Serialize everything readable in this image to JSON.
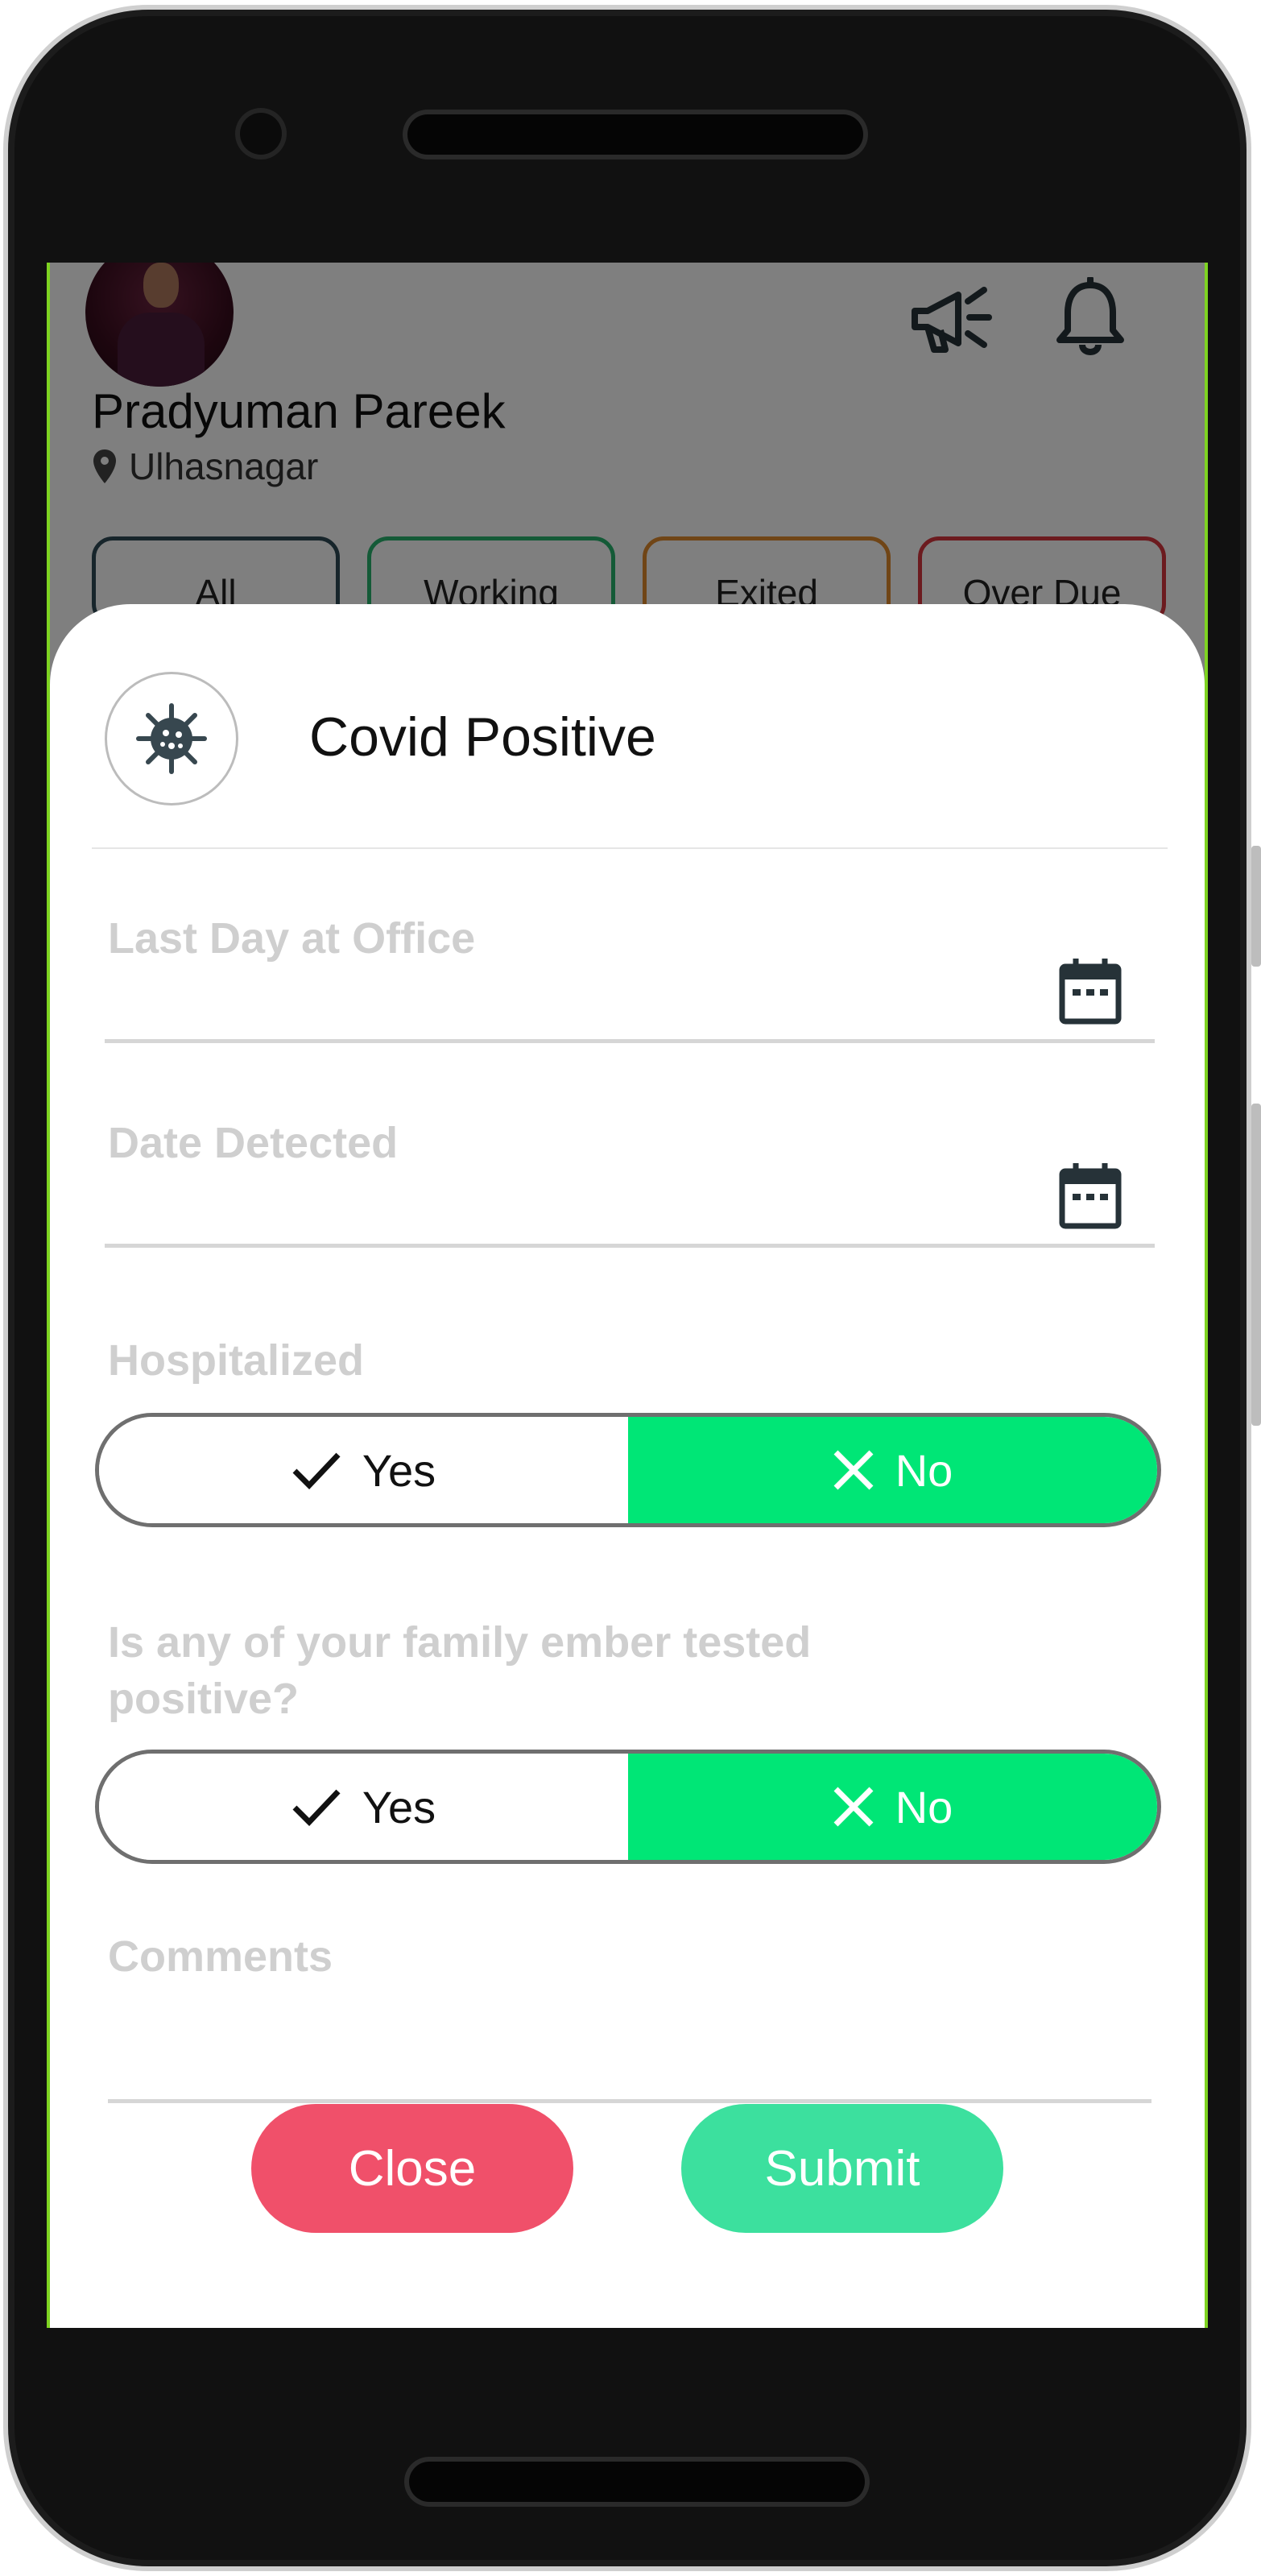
{
  "profile": {
    "name": "Pradyuman Pareek",
    "location": "Ulhasnagar"
  },
  "filters": [
    {
      "label": "All",
      "color": "#2f4a56"
    },
    {
      "label": "Working",
      "color": "#28b46e"
    },
    {
      "label": "Exited",
      "color": "#e08a2c"
    },
    {
      "label": "Over Due",
      "color": "#d9363e"
    }
  ],
  "header_icons": [
    "megaphone-icon",
    "bell-icon"
  ],
  "sheet": {
    "title": "Covid Positive",
    "icon": "virus-icon",
    "fields": {
      "last_day_label": "Last Day at Office",
      "date_detected_label": "Date Detected",
      "hospitalized_label": "Hospitalized",
      "family_label": "Is any of your family ember tested positive?",
      "comments_label": "Comments"
    },
    "toggle": {
      "yes_label": "Yes",
      "no_label": "No",
      "selected": "No",
      "selected_color": "#00e676"
    },
    "buttons": {
      "close_label": "Close",
      "submit_label": "Submit",
      "close_color": "#f0506a",
      "submit_color": "#3ce09e"
    }
  }
}
